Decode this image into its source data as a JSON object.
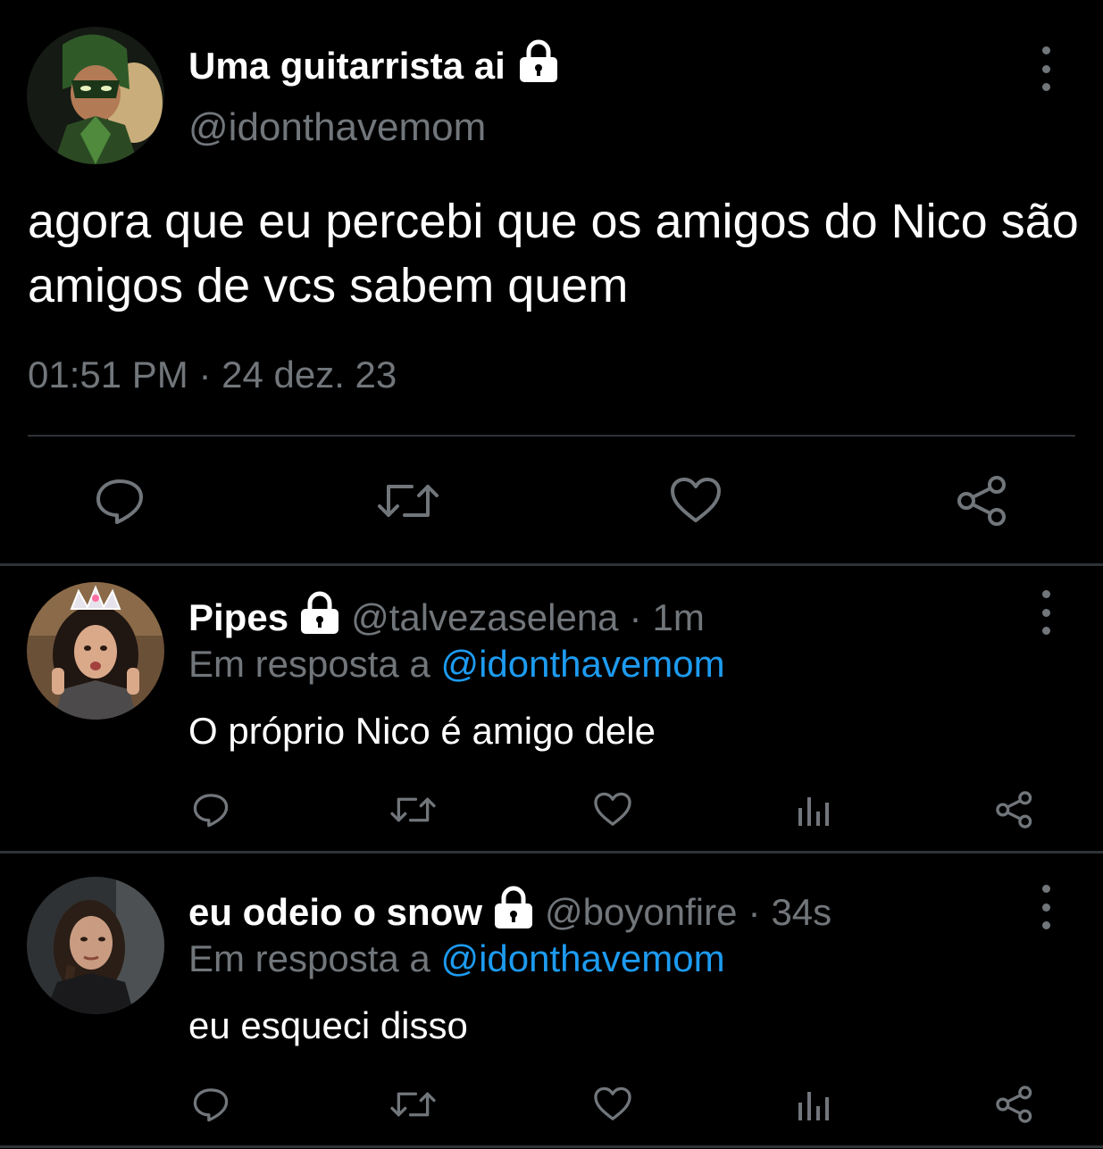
{
  "main_tweet": {
    "display_name": "Uma guitarrista ai",
    "handle": "@idonthavemom",
    "text": "agora que eu percebi que os amigos do Nico são amigos de vcs sabem quem",
    "timestamp": "01:51 PM · 24 dez. 23",
    "avatar": "avatar-hero-archer",
    "actions": [
      "reply-icon",
      "retweet-icon",
      "like-icon",
      "share-icon"
    ]
  },
  "replies": [
    {
      "display_name": "Pipes",
      "handle": "@talvezaselena",
      "time": "1m",
      "reply_prefix": "Em resposta a",
      "reply_to": "@idonthavemom",
      "text": "O próprio Nico é amigo dele",
      "avatar": "avatar-tiara-girl",
      "actions": [
        "reply-icon",
        "retweet-icon",
        "like-icon",
        "views-icon",
        "share-icon"
      ]
    },
    {
      "display_name": "eu odeio o snow",
      "handle": "@boyonfire",
      "time": "34s",
      "reply_prefix": "Em resposta a",
      "reply_to": "@idonthavemom",
      "text": "eu esqueci disso",
      "avatar": "avatar-braid-girl",
      "actions": [
        "reply-icon",
        "retweet-icon",
        "like-icon",
        "views-icon",
        "share-icon"
      ]
    }
  ],
  "colors": {
    "background": "#000000",
    "text": "#ffffff",
    "muted": "#71767b",
    "link": "#1d9bf0",
    "divider": "#2f3336"
  }
}
